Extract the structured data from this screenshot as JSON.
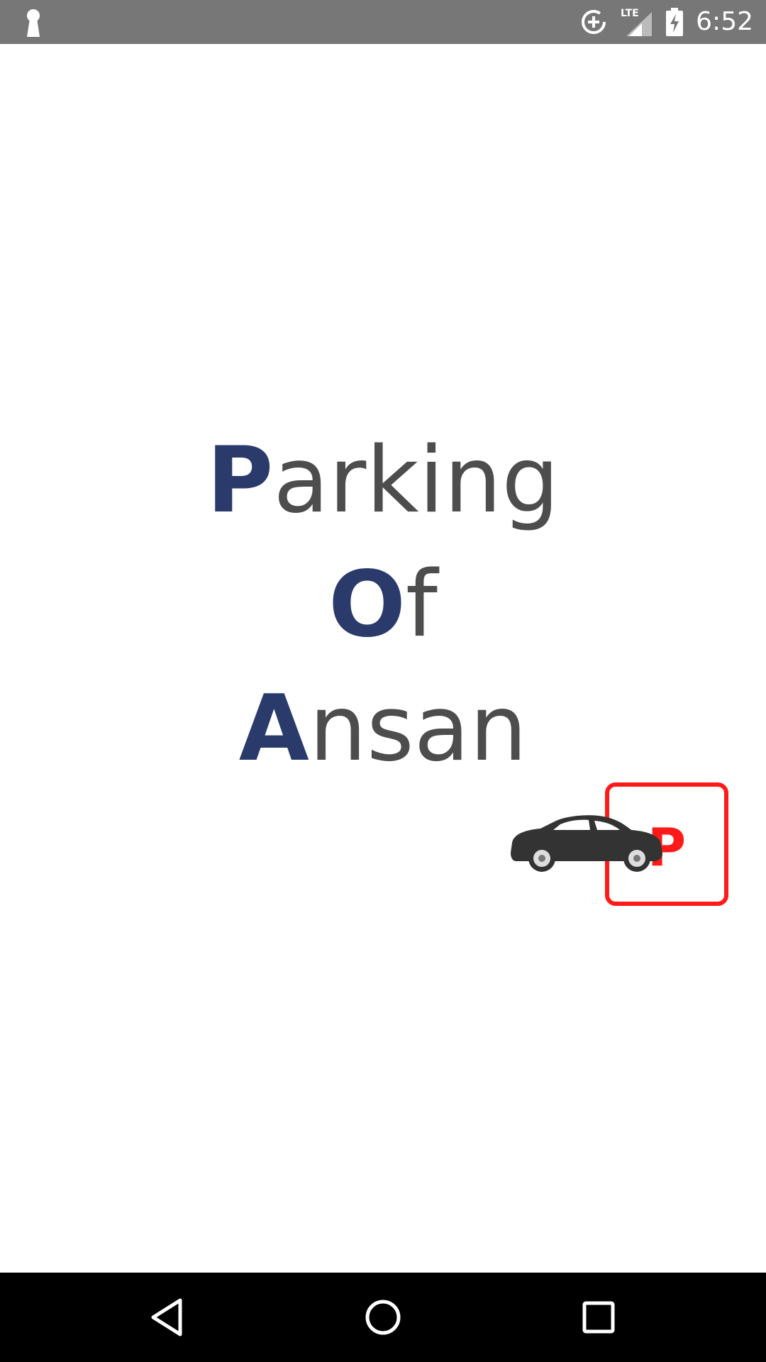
{
  "status_bar": {
    "time": "6:52",
    "network_label": "LTE",
    "icons": [
      "keyhole-icon",
      "data-saver-icon",
      "lte-signal-icon",
      "battery-charging-icon"
    ]
  },
  "title": {
    "line1": {
      "initial": "P",
      "rest": "arking"
    },
    "line2": {
      "initial": "O",
      "rest": "f"
    },
    "line3": {
      "initial": "A",
      "rest": "nsan"
    }
  },
  "logo": {
    "sign_letter": "P",
    "sign_color": "#ff1a1a",
    "car_color": "#333333"
  },
  "colors": {
    "initial_letters": "#2a3a6b",
    "body_letters": "#4d4d4d",
    "status_bar": "#777777",
    "nav_bar": "#000000"
  },
  "nav_bar": {
    "icons": [
      "back-icon",
      "home-icon",
      "recents-icon"
    ]
  }
}
